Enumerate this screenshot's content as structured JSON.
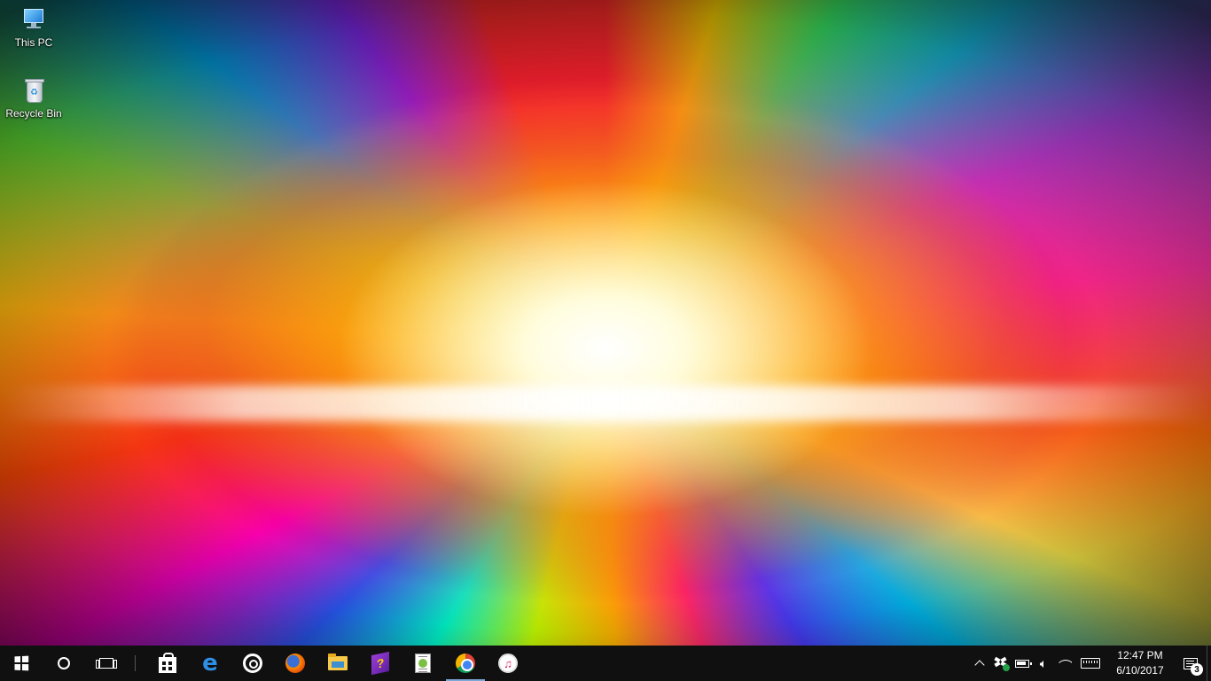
{
  "desktop": {
    "icons": [
      {
        "label": "This PC",
        "icon": "this-pc-icon"
      },
      {
        "label": "Recycle Bin",
        "icon": "recycle-bin-icon"
      }
    ]
  },
  "taskbar": {
    "start": {
      "icon": "windows-logo-icon"
    },
    "search": {
      "icon": "cortana-circle-icon"
    },
    "task_view": {
      "icon": "task-view-icon"
    },
    "pinned_apps": [
      {
        "name": "Store",
        "icon": "store-icon",
        "active": false
      },
      {
        "name": "Microsoft Edge",
        "icon": "edge-icon",
        "glyph": "e",
        "active": false
      },
      {
        "name": "Groove Music",
        "icon": "groove-icon",
        "active": false
      },
      {
        "name": "Firefox",
        "icon": "firefox-icon",
        "active": false
      },
      {
        "name": "File Explorer",
        "icon": "folder-icon",
        "active": false
      },
      {
        "name": "Help",
        "icon": "help-book-icon",
        "glyph": "?",
        "active": false
      },
      {
        "name": "Notepad++",
        "icon": "notepadpp-icon",
        "active": false
      },
      {
        "name": "Google Chrome",
        "icon": "chrome-icon",
        "active": true
      },
      {
        "name": "iTunes",
        "icon": "itunes-icon",
        "glyph": "♫",
        "active": false
      }
    ],
    "tray": {
      "icons": [
        "chevron-up-icon",
        "dropbox-icon",
        "battery-icon",
        "speaker-icon",
        "wifi-icon",
        "keyboard-icon"
      ],
      "time": "12:47 PM",
      "date": "6/10/2017",
      "notification_count": "3"
    }
  },
  "colors": {
    "taskbar_bg": "#101010",
    "active_indicator": "#7aa7d6",
    "edge_blue": "#2f8fe6"
  }
}
